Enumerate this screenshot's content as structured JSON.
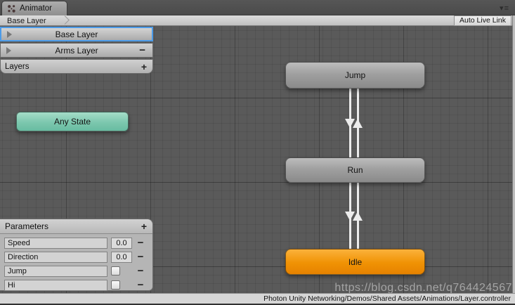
{
  "window": {
    "tab_title": "Animator",
    "menu_icon": "▾≡"
  },
  "breadcrumb": {
    "path": "Base Layer",
    "auto_live_link_label": "Auto Live Link"
  },
  "layers_panel": {
    "rows": [
      {
        "label": "Base Layer",
        "selected": true
      },
      {
        "label": "Arms Layer",
        "selected": false,
        "remove_label": "−"
      }
    ],
    "footer_label": "Layers",
    "add_label": "+"
  },
  "parameters_panel": {
    "title": "Parameters",
    "add_label": "+",
    "rows": [
      {
        "name": "Speed",
        "type": "float",
        "value": "0.0",
        "remove_label": "−"
      },
      {
        "name": "Direction",
        "type": "float",
        "value": "0.0",
        "remove_label": "−"
      },
      {
        "name": "Jump",
        "type": "bool",
        "checked": false,
        "remove_label": "−"
      },
      {
        "name": "Hi",
        "type": "bool",
        "checked": false,
        "remove_label": "−"
      }
    ]
  },
  "graph": {
    "nodes": [
      {
        "id": "any-state",
        "label": "Any State",
        "color": "#68BCA1"
      },
      {
        "id": "jump",
        "label": "Jump",
        "color": "#9A9A9A"
      },
      {
        "id": "run",
        "label": "Run",
        "color": "#9A9A9A"
      },
      {
        "id": "idle",
        "label": "Idle",
        "color": "#F09204"
      }
    ],
    "transitions": [
      {
        "from": "Jump",
        "to": "Run"
      },
      {
        "from": "Run",
        "to": "Jump"
      },
      {
        "from": "Run",
        "to": "Idle"
      },
      {
        "from": "Idle",
        "to": "Run"
      }
    ]
  },
  "colors": {
    "selection_blue": "#4C9BE8",
    "canvas_gray": "#5A5A5A",
    "transition_white": "#ECECEC"
  },
  "status_bar": {
    "path": "Photon Unity Networking/Demos/Shared Assets/Animations/Layer.controller"
  },
  "watermark": {
    "text": "https://blog.csdn.net/q764424567"
  }
}
